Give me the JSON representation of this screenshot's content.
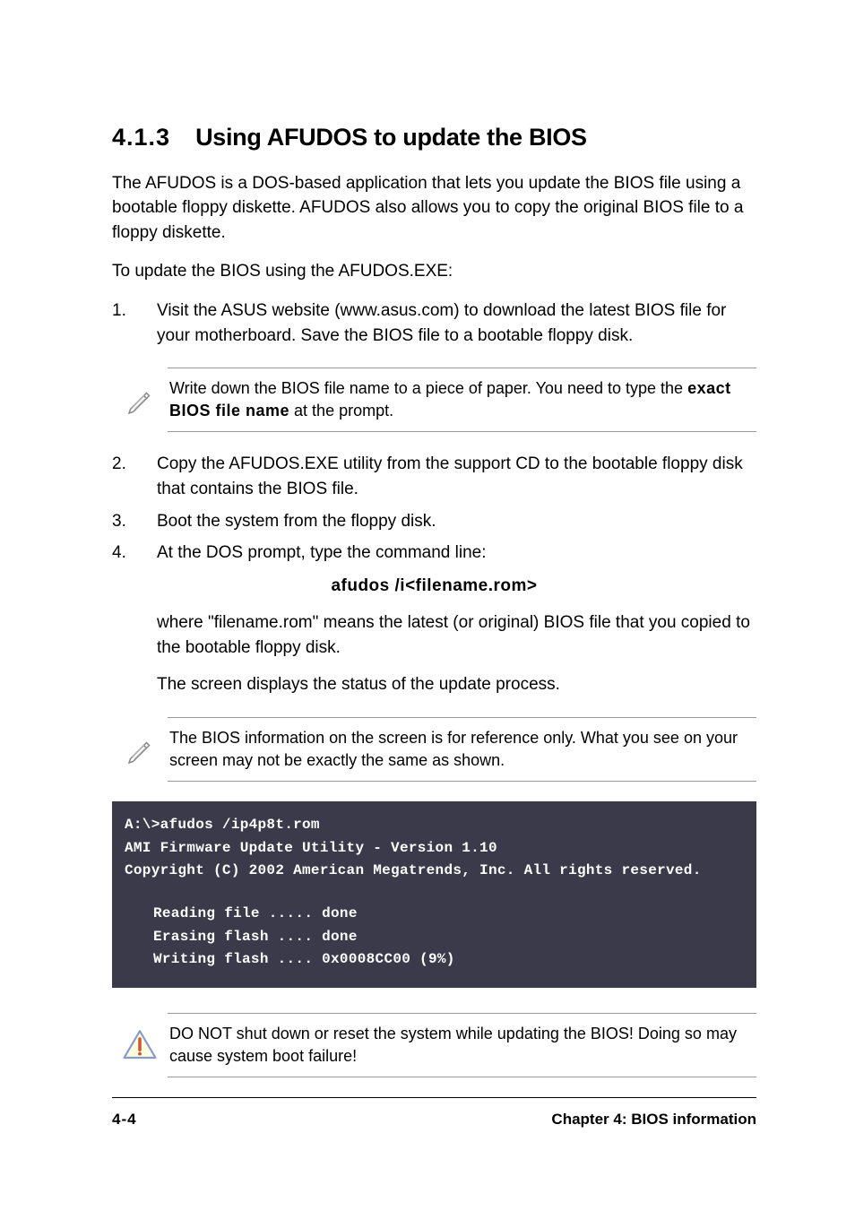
{
  "heading": {
    "number": "4.1.3",
    "title": "Using AFUDOS to update the BIOS"
  },
  "intro": "The AFUDOS is a DOS-based application that lets you update the BIOS file using a bootable floppy diskette. AFUDOS also allows you to copy the original BIOS file to a floppy diskette.",
  "lead": "To update the BIOS using the AFUDOS.EXE:",
  "steps": {
    "s1": "Visit the ASUS website (www.asus.com) to download the latest BIOS file for your motherboard. Save the BIOS file to a bootable floppy disk.",
    "s2": "Copy the AFUDOS.EXE utility from the support CD to the bootable floppy disk that contains the BIOS file.",
    "s3": "Boot the system from the floppy disk.",
    "s4": "At the DOS prompt, type the command line:"
  },
  "note1": {
    "pre": "Write down the BIOS file name to a piece of paper. You need to type the ",
    "bold": "exact BIOS file name",
    "post": " at the prompt."
  },
  "command": "afudos /i<filename.rom>",
  "after_command_1": "where \"filename.rom\" means the latest (or original) BIOS file that you copied to the bootable floppy disk.",
  "after_command_2": "The screen displays the status of the update process.",
  "note2": "The BIOS information on the screen is for reference only. What you see on your screen may not be exactly the same as shown.",
  "terminal": {
    "l1": "A:\\>afudos /ip4p8t.rom",
    "l2": "AMI Firmware Update Utility - Version 1.10",
    "l3": "Copyright (C) 2002 American Megatrends, Inc. All rights reserved.",
    "l4": "Reading file ..... done",
    "l5": "Erasing flash .... done",
    "l6": "Writing flash .... 0x0008CC00 (9%)"
  },
  "warning": "DO NOT shut down or reset the system while updating the BIOS! Doing so may cause system boot failure!",
  "footer": {
    "left": "4-4",
    "right": "Chapter 4: BIOS information"
  }
}
